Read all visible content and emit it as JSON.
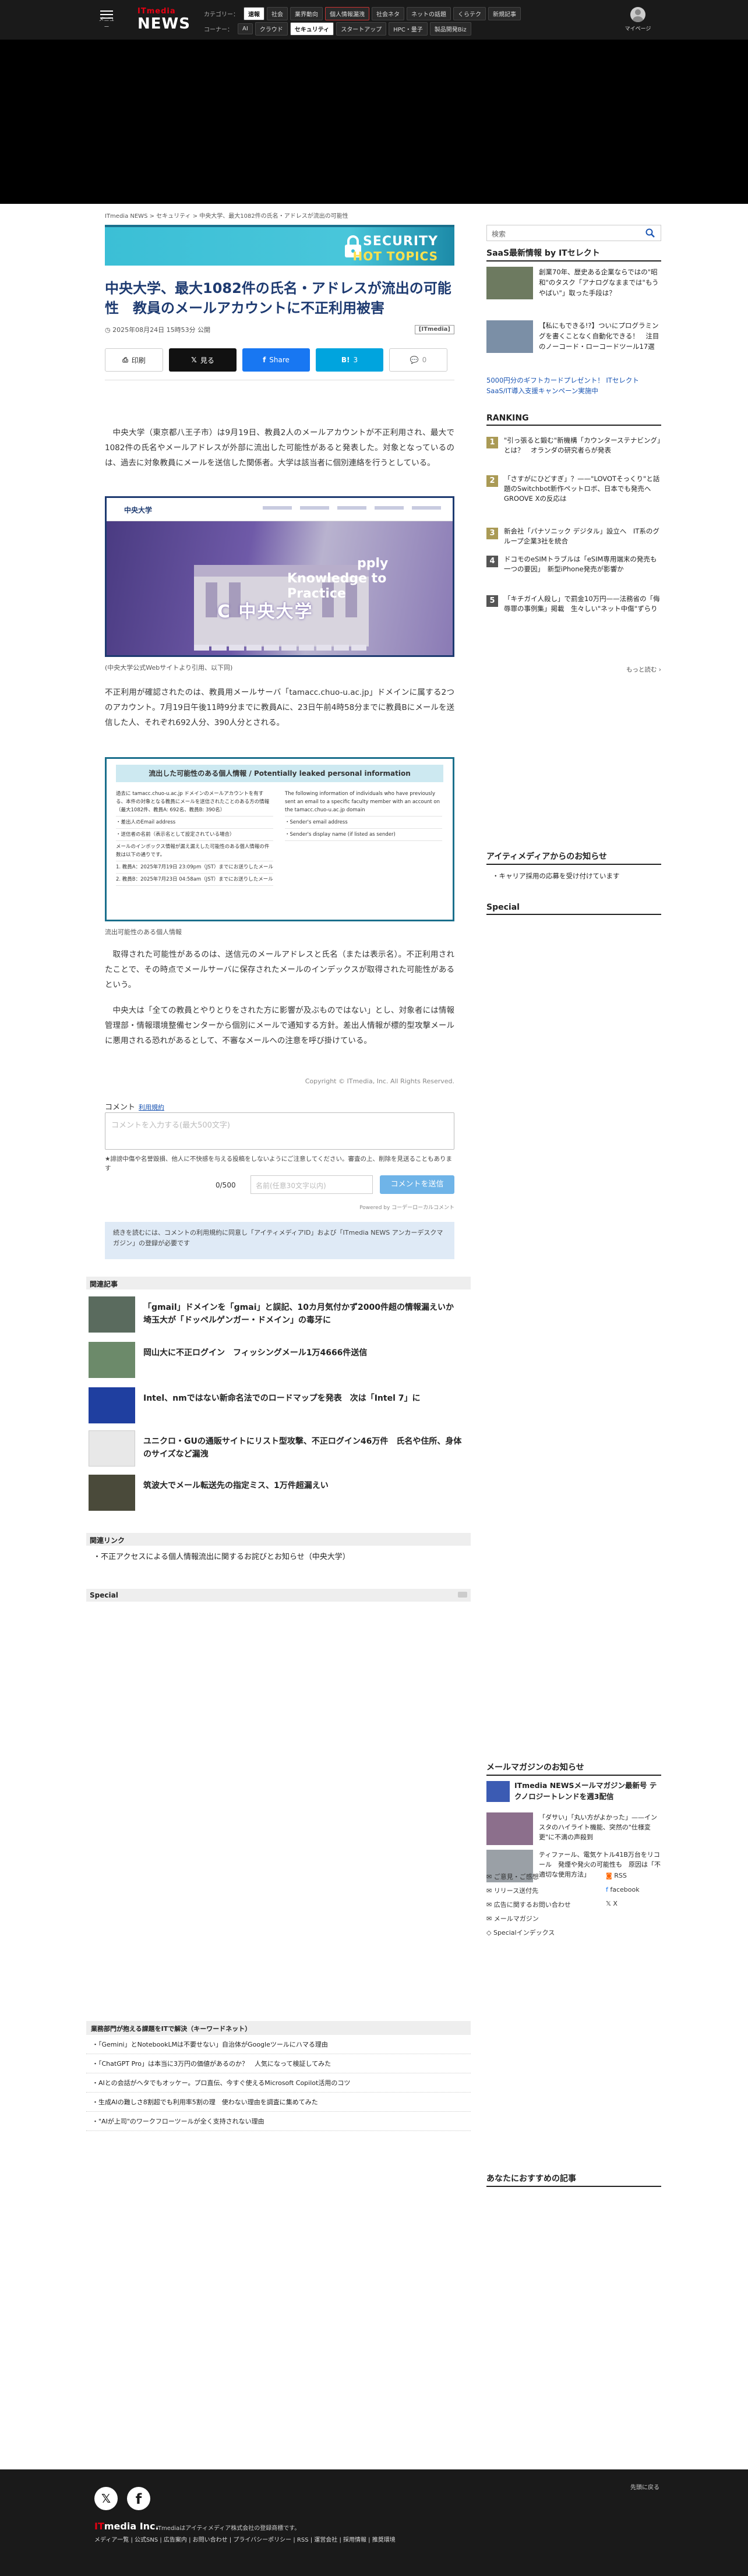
{
  "header": {
    "menu_label": "メニュー",
    "logo_top": "ITmedia",
    "logo_bottom": "NEWS",
    "category_label": "カテゴリー：",
    "categories": [
      "速報",
      "社会",
      "業界動向",
      "個人情報漏洩",
      "社会ネタ",
      "ネットの話題",
      "くらテク",
      "新規記事"
    ],
    "corner_label": "コーナー：",
    "corners": [
      "AI",
      "クラウド",
      "セキュリティ",
      "スタートアップ",
      "HPC・量子",
      "製品開発Biz"
    ],
    "mypage": "マイページ"
  },
  "article": {
    "breadcrumb": "ITmedia NEWS > セキュリティ > 中央大学、最大1082件の氏名・アドレスが流出の可能性",
    "banner_top": "SECURITY",
    "banner_bottom": "HOT TOPICS",
    "title": "中央大学、最大1082件の氏名・アドレスが流出の可能性　教員のメールアカウントに不正利用被害",
    "date": "2025年08月24日 15時53分 公開",
    "brand": "[ITmedia]",
    "share": {
      "print": "印刷",
      "x": "見る",
      "fb": "Share",
      "hb": "3",
      "comment": "0"
    },
    "p1": "中央大学（東京都八王子市）は9月19日、教員2人のメールアカウントが不正利用され、最大で1082件の氏名やメールアドレスが外部に流出した可能性があると発表した。対象となっているのは、過去に対象教員にメールを送信した関係者。大学は該当者に個別連絡を行うとしている。",
    "fig1_site": "中央大学",
    "fig1_overlay1": "Knowledge to",
    "fig1_overlay2": "Practice",
    "fig1_overlay3": "pply",
    "fig1_logo": "C 中央大学",
    "cap1": "(中央大学公式Webサイトより引用、以下同)",
    "p2": "不正利用が確認されたのは、教員用メールサーバ「tamacc.chuo-u.ac.jp」ドメインに属する2つのアカウント。7月19日午後11時9分までに教員Aに、23日午前4時58分までに教員Bにメールを送信した人、それぞれ692人分、390人分とされる。",
    "fig2_head": "流出した可能性のある個人情報 / Potentially leaked personal information",
    "fig2_left": [
      "過去に tamacc.chuo-u.ac.jp ドメインのメールアカウントを有する、本件の対象となる教員にメールを送信されたことのある方の情報（最大1082件、教員A: 692名、教員B: 390名）",
      "・差出人のEmail address",
      "・送信者の名前（表示名として設定されている場合）",
      "メールのインボックス情報が漏え漏えした可能性のある個人情報の件数は以下の通りです。",
      "1. 教員A：2025年7月19日 23:09pm（JST）までにお送りしたメール",
      "2. 教員B：2025年7月23日 04:58am（JST）までにお送りしたメール"
    ],
    "fig2_right": [
      "The following information of individuals who have previously sent an email to a specific faculty member with an account on the tamacc.chuo-u.ac.jp domain",
      "・Sender's email address",
      "・Sender's display name (if listed as sender)",
      ""
    ],
    "cap2": "流出可能性のある個人情報",
    "p3": "取得された可能性があるのは、送信元のメールアドレスと氏名（または表示名）。不正利用されたことで、その時点でメールサーバに保存されたメールのインデックスが取得された可能性があるという。",
    "p4": "中央大は「全ての教員とやりとりをされた方に影響が及ぶものではない」とし、対象者には情報管理部・情報環境整備センターから個別にメールで通知する方針。差出人情報が標的型攻撃メールに悪用される恐れがあるとして、不審なメールへの注意を呼び掛けている。",
    "copyright": "Copyright © ITmedia, Inc. All Rights Reserved."
  },
  "comment": {
    "label": "コメント",
    "terms": "利用規約",
    "placeholder": "コメントを入力する(最大500文字)",
    "note": "★誹謗中傷や名誉毀損、他人に不快感を与える投稿をしないようにご注意してください。審査の上、削除を見送ることもあります",
    "count": "0/500",
    "name_placeholder": "名前(任意30文字以内)",
    "send": "コメントを送信",
    "powered": "Powered by コーデーローカルコメント",
    "consent": "続きを読むには、コメントの利用規約に同意し「アイティメディアID」および「ITmedia NEWS アンカーデスクマガジン」の登録が必要です"
  },
  "related": {
    "title": "関連記事",
    "items": [
      "「gmail」ドメインを「gmai」と誤記、10カ月気付かず2000件超の情報漏えいか　埼玉大が「ドッペルゲンガー・ドメイン」の毒牙に",
      "岡山大に不正ログイン　フィッシングメール1万4666件送信",
      "Intel、nmではない新命名法でのロードマップを発表　次は「Intel 7」に",
      "ユニクロ・GUの通販サイトにリスト型攻撃、不正ログイン46万件　氏名や住所、身体のサイズなど漏洩",
      "筑波大でメール転送先の指定ミス、1万件超漏えい"
    ]
  },
  "links": {
    "title": "関連リンク",
    "items": [
      "不正アクセスによる個人情報流出に関するお詫びとお知らせ（中央大学）"
    ]
  },
  "special": "Special",
  "pr": {
    "title": "業務部門が抱える課題をITで解決（キーワードネット）",
    "items": [
      "「Gemini」とNotebookLMは不要せない」自治体がGoogleツールにハマる理由",
      "「ChatGPT Pro」は本当に3万円の価値があるのか？　人気になって検証してみた",
      "AIとの会話がヘタでもオッケー。プロ直伝、今すぐ使えるMicrosoft Copilot活用のコツ",
      "生成AIの難しさ8割超でも利用率5割の理　使わない理由を調査に集めてみた",
      "\"AIが上司\"のワークフローツールが全く支持されない理由"
    ]
  },
  "sidebar": {
    "search_placeholder": "検索",
    "saas_title": "SaaS最新情報 by ITセレクト",
    "saas_items": [
      "創業70年、歴史ある企業ならではの\"昭和\"のタスク「アナログなままでは\"もうやばい\"」取った手段は？",
      "【私にもできる!?】ついにプログラミングを書くことなく自動化できる！　注目のノーコード・ローコードツール17選"
    ],
    "saas_link": "5000円分のギフトカードプレゼント！ ITセレクトSaaS/IT導入支援キャンペーン実施中",
    "ranking_title": "RANKING",
    "ranking": [
      "\"引っ張ると鍛む\"新機構「カウンターステナビング」とは？　オランダの研究者らが発表",
      "「さすがにひどすぎ」？——\"LOVOTそっくり\"と話題のSwitchbot新作ペットロボ、日本でも発売へ　GROOVE Xの反応は",
      "新会社「パナソニック デジタル」設立へ　IT系のグループ企業3社を統合",
      "ドコモのeSIMトラブルは「eSIM専用端末の発売も一つの要因」　新型iPhone発売が影響か",
      "「キチガイ人殺し」で罰金10万円——法務省の「侮辱罪の事例集」掲載　生々しい\"ネット中傷\"ずらり"
    ],
    "more": "もっと読む ›",
    "idea_title": "アイティメディアからのお知らせ",
    "career": "キャリア採用の応募を受け付けています",
    "special": "Special",
    "mm_title": "メールマガジンのお知らせ",
    "mm_main": "ITmedia NEWSメールマガジン最新号 テクノロジートレンドを週3配信",
    "mm_items": [
      "「ダサい」「丸い方がよかった」——インスタのハイライト機能、突然の\"仕様変更\"に不満の声殺到",
      "ティファール、電気ケトル41B万台をリコール　発煙や発火の可能性も　原因は「不適切な使用方法」"
    ],
    "foot_links": [
      "ご意見・ご感想",
      "RSS",
      "リリース送付先",
      "facebook",
      "広告に関するお問い合わせ",
      "X",
      "メールマガジン",
      "",
      "Specialインデックス",
      ""
    ],
    "recommend": "あなたにおすすめの記事"
  },
  "footer": {
    "to_top": "先頭に戻る",
    "logo_it": "IT",
    "logo_rest": "media Inc.",
    "note": "ITmediaはアイティメディア株式会社の登録商標です。",
    "links": "メディア一覧 | 公式SNS | 広告案内 | お問い合わせ | プライバシーポリシー | RSS | 運営会社 | 採用情報 | 推奨環境"
  }
}
